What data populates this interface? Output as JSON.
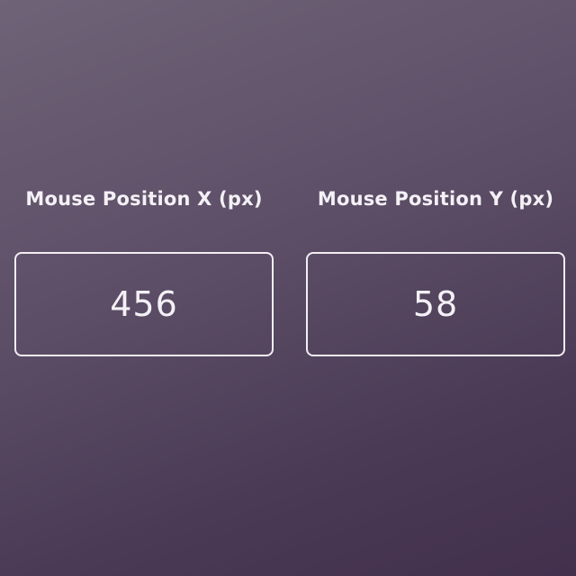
{
  "readouts": [
    {
      "label": "Mouse Position X (px)",
      "value": "456"
    },
    {
      "label": "Mouse Position Y (px)",
      "value": "58"
    }
  ],
  "colors": {
    "background_start": "#6e6377",
    "background_end": "#42304d",
    "text": "#f4f1f6",
    "border": "#f2eef4"
  }
}
